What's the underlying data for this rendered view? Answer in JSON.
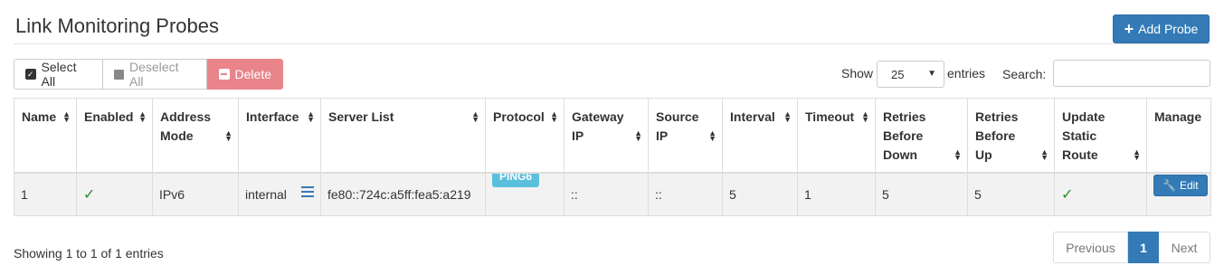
{
  "page": {
    "title": "Link Monitoring Probes",
    "add_label": "Add Probe"
  },
  "toolbar": {
    "select_all": "Select All",
    "deselect_all": "Deselect All",
    "delete": "Delete"
  },
  "length": {
    "show": "Show",
    "value": "25",
    "entries": "entries"
  },
  "search": {
    "label": "Search:",
    "value": ""
  },
  "table": {
    "headers": {
      "name": "Name",
      "enabled": "Enabled",
      "address_mode": "Address Mode",
      "interface": "Interface",
      "server_list": "Server List",
      "protocol": "Protocol",
      "gateway_ip": "Gateway IP",
      "source_ip": "Source IP",
      "interval": "Interval",
      "timeout": "Timeout",
      "retries_down": "Retries Before Down",
      "retries_up": "Retries Before Up",
      "update_static_route": "Update Static Route",
      "manage": "Manage"
    },
    "rows": [
      {
        "name": "1",
        "enabled": true,
        "address_mode": "IPv6",
        "interface": "internal",
        "server_list": "fe80::724c:a5ff:fea5:a219",
        "protocol": "PING6",
        "gateway_ip": "::",
        "source_ip": "::",
        "interval": "5",
        "timeout": "1",
        "retries_down": "5",
        "retries_up": "5",
        "update_static_route": true,
        "edit_label": "Edit"
      }
    ]
  },
  "footer": {
    "info": "Showing 1 to 1 of 1 entries",
    "previous": "Previous",
    "page": "1",
    "next": "Next"
  },
  "colors": {
    "primary": "#337ab7",
    "danger": "#e8848a",
    "info": "#5bc0de",
    "success": "#2d8a2d"
  },
  "icons": {
    "add": "plus-icon",
    "select_all": "check-square-icon",
    "deselect_all": "square-icon",
    "delete": "minus-square-icon",
    "enabled": "checkmark-icon",
    "interface_detail": "list-icon",
    "edit": "wrench-icon",
    "dropdown": "chevron-down-icon",
    "sort": "sort-icon"
  }
}
